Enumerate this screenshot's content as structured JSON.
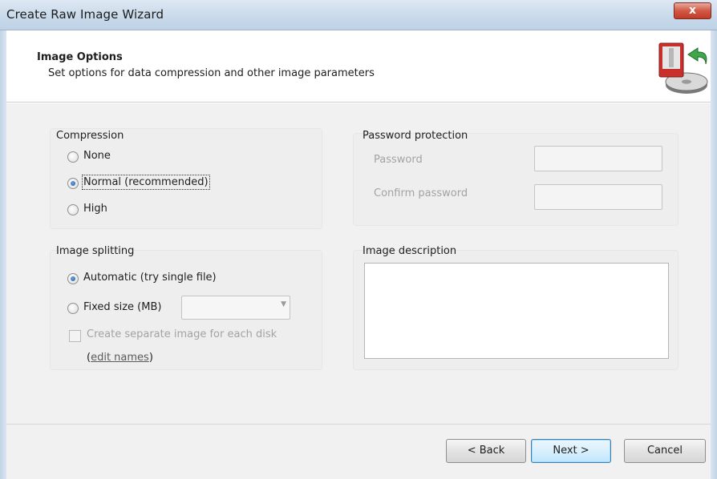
{
  "window": {
    "title": "Create Raw Image Wizard",
    "close_glyph": "x"
  },
  "header": {
    "title": "Image Options",
    "subtitle": "Set options for data compression and other image parameters",
    "icon": "disk-image-icon"
  },
  "compression": {
    "label": "Compression",
    "options": [
      {
        "label": "None",
        "checked": false
      },
      {
        "label": "Normal (recommended)",
        "checked": true
      },
      {
        "label": "High",
        "checked": false
      }
    ]
  },
  "password": {
    "label": "Password protection",
    "password_label": "Password",
    "password_value": "",
    "confirm_label": "Confirm password",
    "confirm_value": ""
  },
  "splitting": {
    "label": "Image splitting",
    "automatic_label": "Automatic (try single file)",
    "automatic_checked": true,
    "fixed_label": "Fixed size (MB)",
    "fixed_checked": false,
    "fixed_value": "",
    "separate_label": "Create separate image for each disk",
    "separate_checked": false,
    "edit_open": "(",
    "edit_link": "edit names",
    "edit_close": ")"
  },
  "description": {
    "label": "Image description",
    "value": ""
  },
  "buttons": {
    "back": "< Back",
    "next": "Next >",
    "cancel": "Cancel"
  },
  "colors": {
    "titlebar": "#c8d9ea",
    "content_bg": "#f1f1f1",
    "disabled_text": "#a3a3a3",
    "default_button_border": "#3c7fb1"
  }
}
